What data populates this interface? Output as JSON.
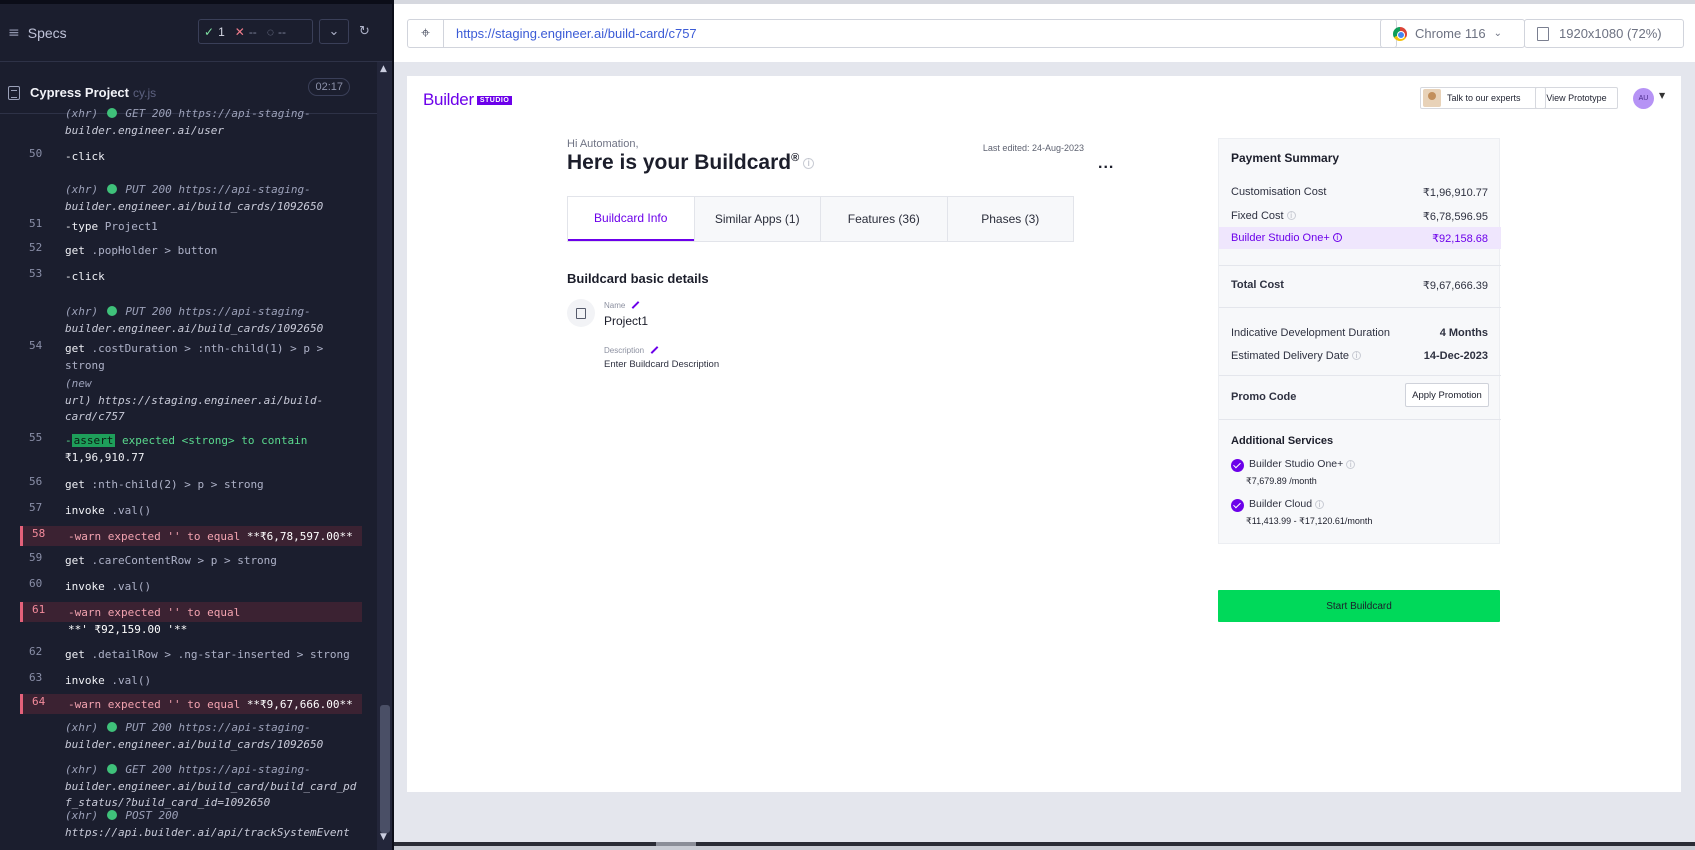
{
  "cypress": {
    "specs_label": "Specs",
    "stats": {
      "passed": "1",
      "failed": "--",
      "pending": "--"
    },
    "project": {
      "name": "Cypress Project",
      "ext": "cy.js",
      "time": "02:17"
    }
  },
  "log": [
    {
      "num": "",
      "kind": "xhr",
      "parts": [
        "(xhr)",
        "GET 200 https://api-staging-",
        "builder.engineer.ai/user"
      ]
    },
    {
      "num": "50",
      "kind": "cmd",
      "cmd": "-click",
      "arg": ""
    },
    {
      "num": "",
      "kind": "xhr",
      "parts": [
        "(xhr)",
        "PUT 200 https://api-staging-",
        "builder.engineer.ai/build_cards/1092650"
      ]
    },
    {
      "num": "51",
      "kind": "cmd",
      "cmd": "-type",
      "arg": "Project1"
    },
    {
      "num": "52",
      "kind": "cmd",
      "cmd": "get",
      "arg": ".popHolder > button"
    },
    {
      "num": "53",
      "kind": "cmd",
      "cmd": "-click",
      "arg": ""
    },
    {
      "num": "",
      "kind": "xhr",
      "parts": [
        "(xhr)",
        "PUT 200 https://api-staging-",
        "builder.engineer.ai/build_cards/1092650"
      ]
    },
    {
      "num": "54",
      "kind": "cmd2",
      "cmd": "get",
      "arg": ".costDuration > :nth-child(1) > p >",
      "arg2": "strong"
    },
    {
      "num": "",
      "kind": "newurl",
      "parts": [
        "(new",
        "url)  https://staging.engineer.ai/build-",
        "card/c757"
      ]
    },
    {
      "num": "55",
      "kind": "assert",
      "badge": "assert",
      "text": "expected <strong> to contain",
      "val": "₹1,96,910.77"
    },
    {
      "num": "56",
      "kind": "cmd",
      "cmd": "get",
      "arg": ":nth-child(2) > p > strong"
    },
    {
      "num": "57",
      "kind": "cmd",
      "cmd": "invoke",
      "arg": ".val()"
    },
    {
      "num": "58",
      "kind": "warn",
      "text": "-warn  expected '' to equal",
      "val": "**₹6,78,597.00**"
    },
    {
      "num": "59",
      "kind": "cmd",
      "cmd": "get",
      "arg": ".careContentRow > p > strong"
    },
    {
      "num": "60",
      "kind": "cmd",
      "cmd": "invoke",
      "arg": ".val()"
    },
    {
      "num": "61",
      "kind": "warn2",
      "text": "-warn  expected '' to equal",
      "val": "**' ₹92,159.00  '**"
    },
    {
      "num": "62",
      "kind": "cmd",
      "cmd": "get",
      "arg": ".detailRow > .ng-star-inserted > strong"
    },
    {
      "num": "63",
      "kind": "cmd",
      "cmd": "invoke",
      "arg": ".val()"
    },
    {
      "num": "64",
      "kind": "warn",
      "text": "-warn  expected '' to equal",
      "val": "**₹9,67,666.00**"
    },
    {
      "num": "",
      "kind": "xhr",
      "parts": [
        "(xhr)",
        "PUT 200 https://api-staging-",
        "builder.engineer.ai/build_cards/1092650"
      ]
    },
    {
      "num": "",
      "kind": "xhr3",
      "parts": [
        "(xhr)",
        "GET 200 https://api-staging-",
        "builder.engineer.ai/build_card/build_card_pd",
        "f_status/?build_card_id=1092650"
      ]
    },
    {
      "num": "",
      "kind": "xhr",
      "parts": [
        "(xhr)",
        "POST 200",
        "https://api.builder.ai/api/trackSystemEvent"
      ]
    }
  ],
  "browser": {
    "url": "https://staging.engineer.ai/build-card/c757",
    "browser_name": "Chrome 116",
    "viewport": "1920x1080 (72%)"
  },
  "app": {
    "logo_text": "Builder",
    "logo_badge": "STUDIO",
    "talk_experts": "Talk to our experts",
    "view_prototype": "View Prototype",
    "avatar_initials": "AU",
    "greeting": "Hi Automation,",
    "title": "Here is your Buildcard",
    "title_reg": "®",
    "last_edited": "Last edited: 24-Aug-2023",
    "more": "...",
    "tabs": [
      "Buildcard Info",
      "Similar Apps (1)",
      "Features (36)",
      "Phases (3)"
    ],
    "section_title": "Buildcard basic details",
    "name_label": "Name",
    "name_value": "Project1",
    "desc_label": "Description",
    "desc_value": "Enter Buildcard Description"
  },
  "payment": {
    "title": "Payment Summary",
    "customisation_label": "Customisation Cost",
    "customisation_value": "₹1,96,910.77",
    "fixed_label": "Fixed Cost",
    "fixed_value": "₹6,78,596.95",
    "one_label": "Builder Studio One+",
    "one_value": "₹92,158.68",
    "total_label": "Total Cost",
    "total_value": "₹9,67,666.39",
    "duration_label": "Indicative Development Duration",
    "duration_value": "4 Months",
    "delivery_label": "Estimated Delivery Date",
    "delivery_value": "14-Dec-2023",
    "promo_label": "Promo Code",
    "apply_label": "Apply Promotion",
    "additional_title": "Additional Services",
    "service1_name": "Builder Studio One+",
    "service1_price": "₹7,679.89 /month",
    "service2_name": "Builder Cloud",
    "service2_price": "₹11,413.99 - ₹17,120.61/month",
    "start_label": "Start Buildcard"
  },
  "colors": {
    "accent": "#6c00ea",
    "start": "#00d95a",
    "cy_bg": "#1b1e2e",
    "warn": "#3b2232"
  }
}
